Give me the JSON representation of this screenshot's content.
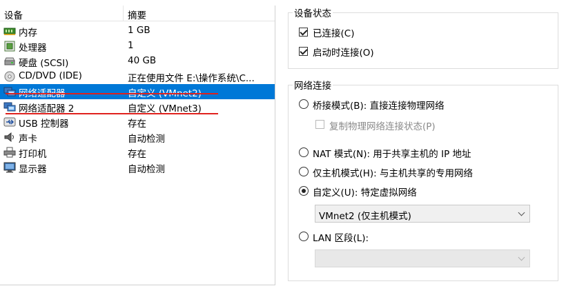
{
  "device_list": {
    "columns": [
      "设备",
      "摘要"
    ],
    "rows": [
      {
        "icon": "memory-icon",
        "name": "内存",
        "summary": "1 GB"
      },
      {
        "icon": "processor-icon",
        "name": "处理器",
        "summary": "1"
      },
      {
        "icon": "hard-disk-icon",
        "name": "硬盘 (SCSI)",
        "summary": "40 GB"
      },
      {
        "icon": "cd-dvd-icon",
        "name": "CD/DVD (IDE)",
        "summary": "正在使用文件 E:\\操作系统\\C..."
      },
      {
        "icon": "network-adapter-icon",
        "name": "网络适配器",
        "summary": "自定义 (VMnet2)"
      },
      {
        "icon": "network-adapter-icon",
        "name": "网络适配器 2",
        "summary": "自定义 (VMnet3)"
      },
      {
        "icon": "usb-icon",
        "name": "USB 控制器",
        "summary": "存在"
      },
      {
        "icon": "sound-card-icon",
        "name": "声卡",
        "summary": "自动检测"
      },
      {
        "icon": "printer-icon",
        "name": "打印机",
        "summary": "存在"
      },
      {
        "icon": "display-icon",
        "name": "显示器",
        "summary": "自动检测"
      }
    ],
    "selected_index": 4
  },
  "device_status": {
    "title": "设备状态",
    "connected_label": "已连接(C)",
    "connected_checked": true,
    "connect_at_power_on_label": "启动时连接(O)",
    "connect_at_power_on_checked": true
  },
  "network_connection": {
    "title": "网络连接",
    "bridged_label": "桥接模式(B): 直接连接物理网络",
    "replicate_label": "复制物理网络连接状态(P)",
    "nat_label": "NAT 模式(N): 用于共享主机的 IP 地址",
    "host_only_label": "仅主机模式(H): 与主机共享的专用网络",
    "custom_label": "自定义(U): 特定虚拟网络",
    "custom_selected_value": "VMnet2 (仅主机模式)",
    "lan_label": "LAN 区段(L):",
    "lan_selected_value": "",
    "selected_option": "custom"
  },
  "colors": {
    "selection": "#0078d7",
    "annotation_line": "#e0201c"
  }
}
